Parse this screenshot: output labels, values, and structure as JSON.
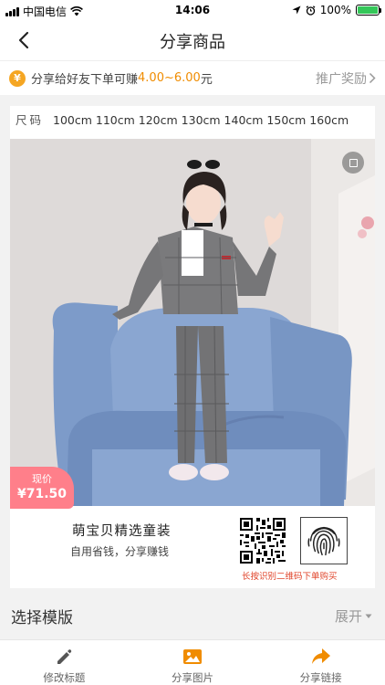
{
  "status_bar": {
    "carrier": "中国电信",
    "time": "14:06",
    "battery": "100%"
  },
  "nav": {
    "title": "分享商品"
  },
  "promo": {
    "coin_symbol": "¥",
    "text": "分享给好友下单可赚",
    "range": "4.00~6.00",
    "unit": "元",
    "link": "推广奖励"
  },
  "product": {
    "size_label": "尺码",
    "sizes": "100cm 110cm 120cm 130cm 140cm 150cm 160cm",
    "price_label": "现价",
    "price": "¥71.50",
    "shop_name": "萌宝贝精选童装",
    "slogan": "自用省钱，分享赚钱",
    "qr_hint": "长按识别二维码下单购买"
  },
  "template": {
    "title": "选择模版",
    "expand": "展开"
  },
  "tabs": [
    {
      "label": "修改标题",
      "icon": "edit-icon"
    },
    {
      "label": "分享图片",
      "icon": "image-icon"
    },
    {
      "label": "分享链接",
      "icon": "share-arrow-icon"
    }
  ],
  "colors": {
    "accent": "#f08c00",
    "price_badge": "#ff7f8a",
    "hint_red": "#e0452b",
    "battery_green": "#34c759"
  }
}
